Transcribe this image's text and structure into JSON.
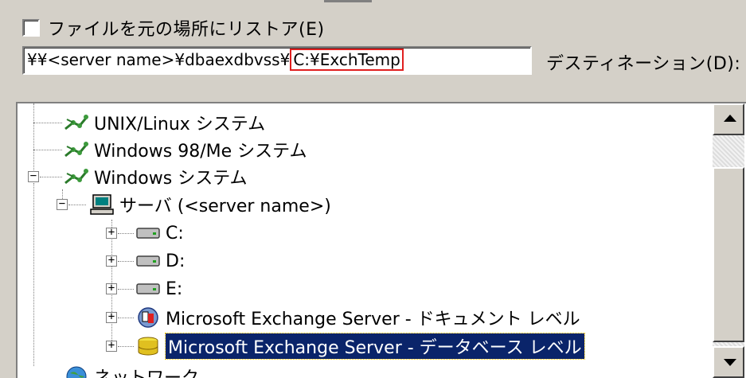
{
  "restore": {
    "checkbox_label": "ファイルを元の場所にリストア(E)",
    "checked": false
  },
  "path": {
    "prefix": "¥¥<server name>¥dbaexdbvss¥",
    "highlight": "C:¥ExchTemp"
  },
  "destination_label": "デスティネーション(D):",
  "tree": {
    "items": [
      {
        "label": "UNIX/Linux システム",
        "icon": "network-icon"
      },
      {
        "label": "Windows 98/Me システム",
        "icon": "network-icon"
      },
      {
        "label": "Windows システム",
        "icon": "network-icon",
        "expander": "−"
      },
      {
        "label": "サーバ (<server name>)",
        "icon": "computer-icon",
        "expander": "−"
      },
      {
        "label": "C:",
        "icon": "drive-icon",
        "expander": "+"
      },
      {
        "label": "D:",
        "icon": "drive-icon",
        "expander": "+"
      },
      {
        "label": "E:",
        "icon": "drive-icon",
        "expander": "+"
      },
      {
        "label": "Microsoft Exchange Server - ドキュメント レベル",
        "icon": "exchange-doc-icon",
        "expander": "+"
      },
      {
        "label": "Microsoft Exchange Server - データベース レベル",
        "icon": "database-icon",
        "expander": "+",
        "selected": true
      },
      {
        "label": "ネットワーク",
        "icon": "globe-icon"
      }
    ]
  },
  "colors": {
    "selection": "#0a246a",
    "highlight_border": "#e02020",
    "face": "#d4d0c8"
  }
}
